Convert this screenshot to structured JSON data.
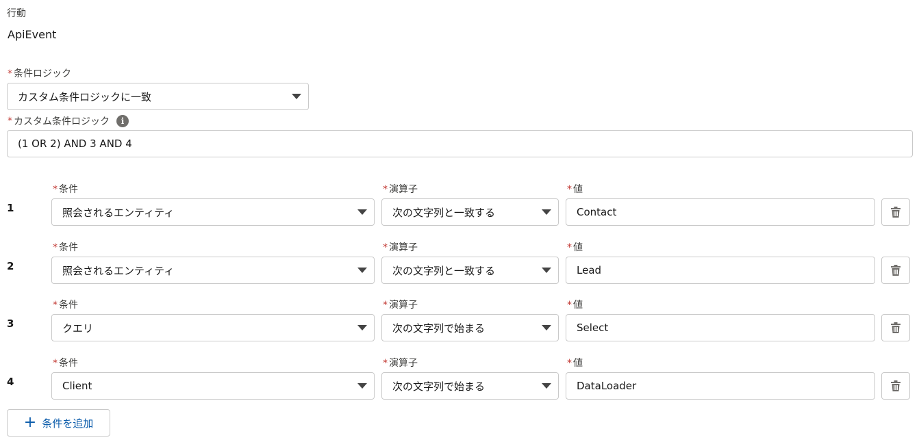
{
  "event": {
    "label": "行動",
    "value": "ApiEvent"
  },
  "logic": {
    "label": "条件ロジック",
    "selected": "カスタム条件ロジックに一致",
    "custom_label": "カスタム条件ロジック",
    "custom_value": "(1 OR 2) AND 3 AND 4"
  },
  "labels": {
    "field": "条件",
    "operator": "演算子",
    "value": "値",
    "required": "*"
  },
  "conditions": [
    {
      "num": "1",
      "field": "照会されるエンティティ",
      "operator": "次の文字列と一致する",
      "value": "Contact"
    },
    {
      "num": "2",
      "field": "照会されるエンティティ",
      "operator": "次の文字列と一致する",
      "value": "Lead"
    },
    {
      "num": "3",
      "field": "クエリ",
      "operator": "次の文字列で始まる",
      "value": "Select"
    },
    {
      "num": "4",
      "field": "Client",
      "operator": "次の文字列で始まる",
      "value": "DataLoader"
    }
  ],
  "add_button": {
    "label": "条件を追加",
    "icon": "plus-icon"
  },
  "colors": {
    "required": "#c23934",
    "link": "#0b5cab",
    "border": "#c9c9c9"
  }
}
